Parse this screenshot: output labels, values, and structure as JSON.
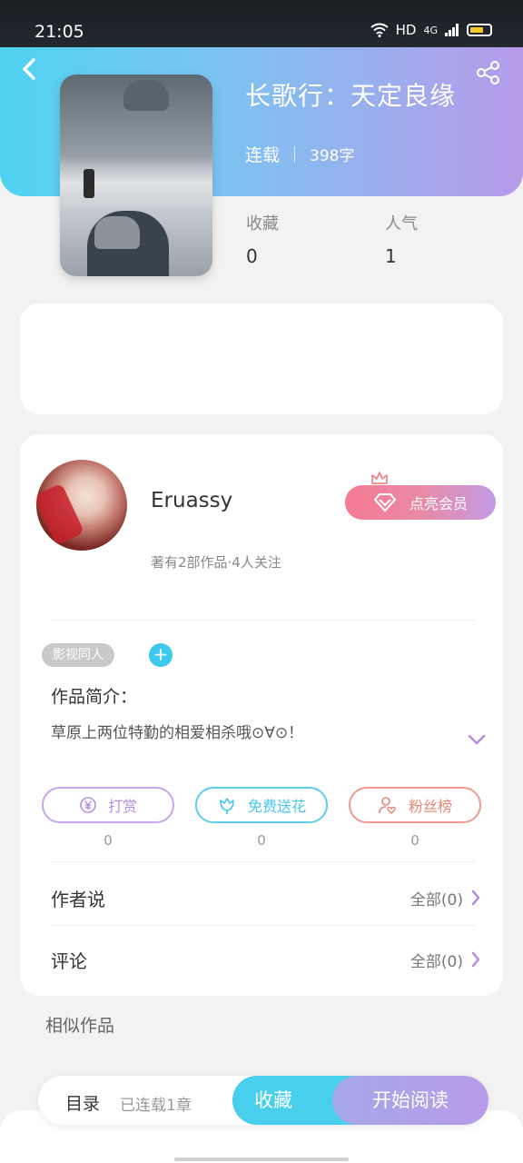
{
  "status_bar": {
    "time": "21:05",
    "network": "HD",
    "signal": "4G"
  },
  "book": {
    "title": "长歌行：天定良缘",
    "status": "连载",
    "word_count": "398字",
    "stats": [
      {
        "label": "收藏",
        "value": "0"
      },
      {
        "label": "人气",
        "value": "1"
      }
    ]
  },
  "author": {
    "name": "Eruassy",
    "meta": "著有2部作品·4人关注",
    "vip_label": "点亮会员"
  },
  "tags": [
    "影视同人"
  ],
  "intro": {
    "heading": "作品简介：",
    "text": "草原上两位特勤的相爱相杀哦⊙∀⊙！"
  },
  "actions": [
    {
      "label": "打赏",
      "count": "0",
      "color": "#b58ee0"
    },
    {
      "label": "免费送花",
      "count": "0",
      "color": "#45c8e8"
    },
    {
      "label": "粉丝榜",
      "count": "0",
      "color": "#e8857a"
    }
  ],
  "rows": [
    {
      "title": "作者说",
      "right": "全部(0)"
    },
    {
      "title": "评论",
      "right": "全部(0)"
    }
  ],
  "similar_heading": "相似作品",
  "bottom": {
    "toc": "目录",
    "chapters": "已连载1章",
    "collect": "收藏",
    "read": "开始阅读"
  }
}
